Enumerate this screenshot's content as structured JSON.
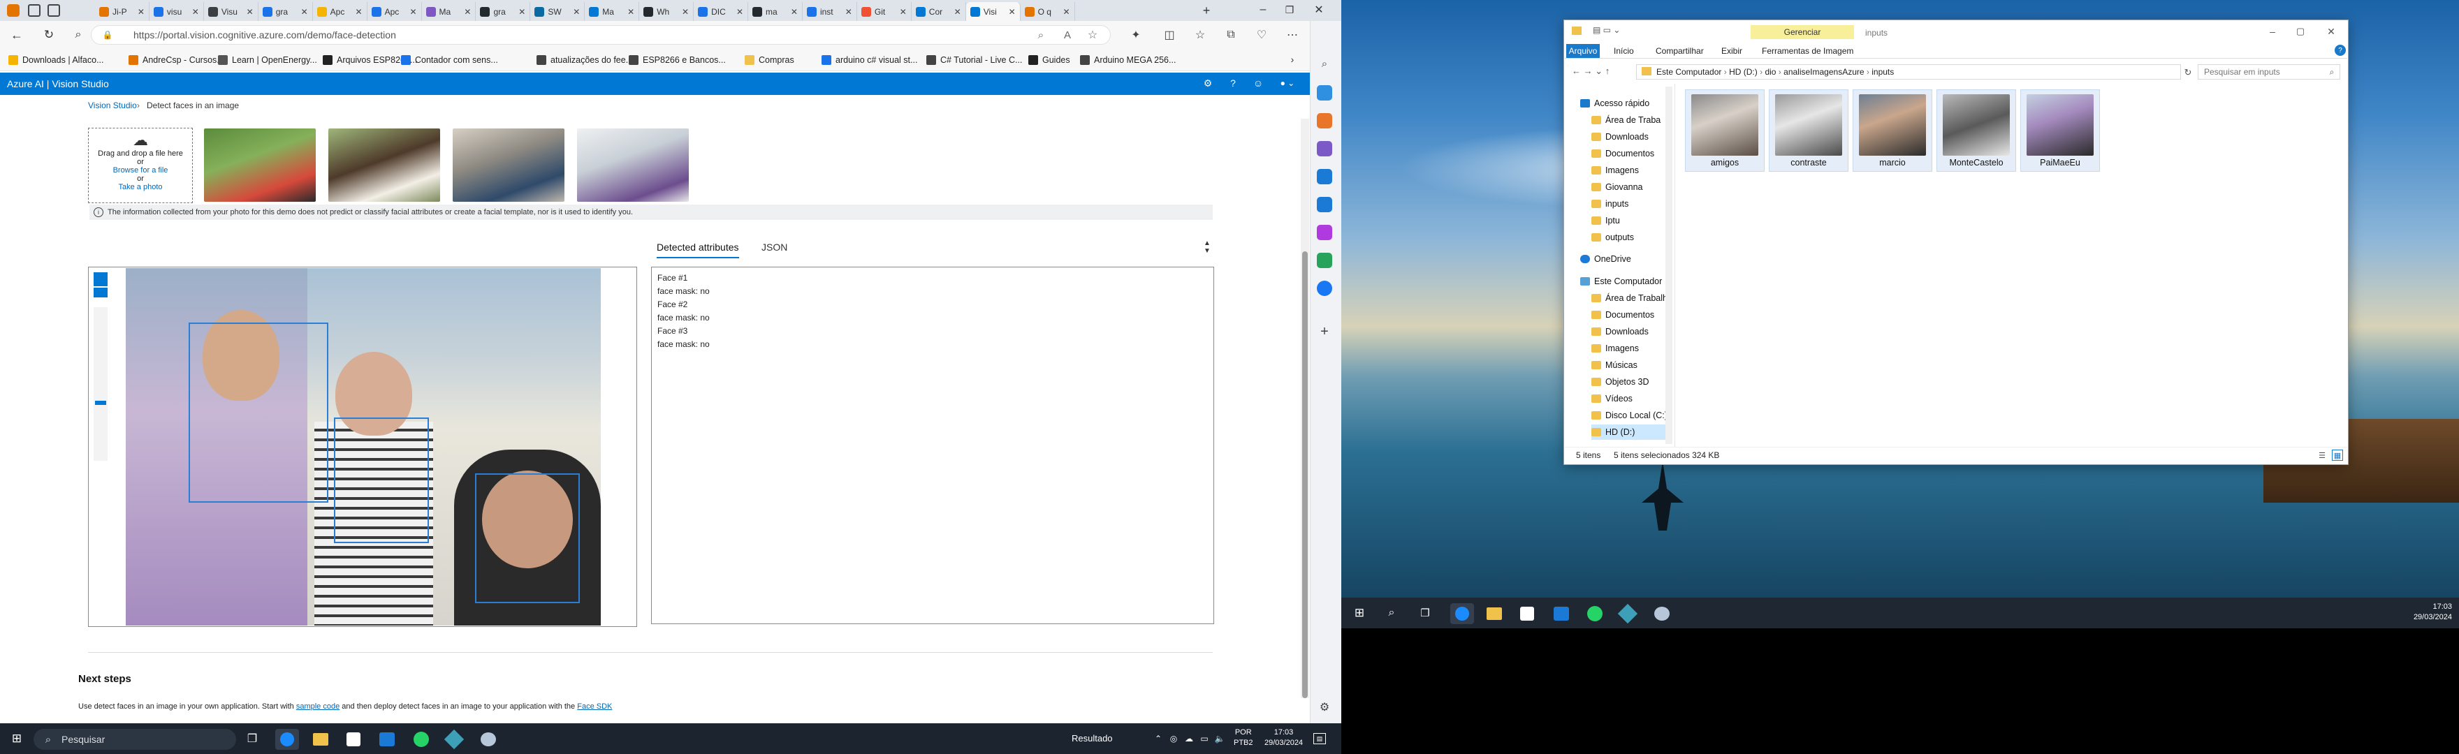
{
  "browser": {
    "tabs": [
      {
        "label": "Ji-P",
        "color": "#e37400"
      },
      {
        "label": "visu",
        "color": "#1a73e8"
      },
      {
        "label": "Visu",
        "color": "#3c4043"
      },
      {
        "label": "gra",
        "color": "#1a73e8"
      },
      {
        "label": "Apc",
        "color": "#f4b400"
      },
      {
        "label": "Apc",
        "color": "#1a73e8"
      },
      {
        "label": "Ma",
        "color": "#7e57c2"
      },
      {
        "label": "gra",
        "color": "#24292e"
      },
      {
        "label": "SW",
        "color": "#0b6aa2"
      },
      {
        "label": "Ma",
        "color": "#0078d4"
      },
      {
        "label": "Wh",
        "color": "#24292e"
      },
      {
        "label": "DIC",
        "color": "#1a73e8"
      },
      {
        "label": "ma",
        "color": "#24292e"
      },
      {
        "label": "inst",
        "color": "#1a73e8"
      },
      {
        "label": "Git",
        "color": "#f05133"
      },
      {
        "label": "Cor",
        "color": "#0078d4"
      },
      {
        "label": "Visi",
        "color": "#0078d4"
      },
      {
        "label": "O q",
        "color": "#e37400"
      }
    ],
    "url": "https://portal.vision.cognitive.azure.com/demo/face-detection",
    "favorites": [
      "Downloads | Alfaco...",
      "AndreCsp - Cursos...",
      "Learn | OpenEnergy...",
      "Arquivos ESP8266...",
      "Contador com sens...",
      "atualizações do fee...",
      "ESP8266 e Bancos...",
      "Compras",
      "arduino c# visual st...",
      "C# Tutorial - Live C...",
      "Guides",
      "Arduino MEGA 256..."
    ]
  },
  "azure": {
    "header": "Azure AI  |  Vision Studio",
    "crumb_root": "Vision Studio",
    "crumb_page": "Detect faces in an image",
    "drop_lines": [
      "Drag and drop a file here",
      "or",
      "Browse for a file",
      "or",
      "Take a photo"
    ],
    "info": "The information collected from your photo for this demo does not predict or classify facial attributes or create a facial template, nor is it used to identify you.",
    "tabs": [
      "Detected attributes",
      "JSON"
    ],
    "attributes": [
      "Face #1",
      "face mask: no",
      "Face #2",
      "face mask: no",
      "Face #3",
      "face mask: no"
    ],
    "next_steps_title": "Next steps",
    "next_steps_text_a": "Use detect faces in an image in your own application. Start with",
    "next_steps_link_a": "sample code",
    "next_steps_text_b": "and then deploy detect faces in an image to your application with the",
    "next_steps_link_b": "Face SDK"
  },
  "taskbar_left": {
    "search": "Pesquisar",
    "tray_label": "Resultado",
    "lang": "POR",
    "lang2": "PTB2",
    "time": "17:03",
    "date": "29/03/2024"
  },
  "explorer": {
    "ribbon_context": "Gerenciar",
    "title": "inputs",
    "tabs": [
      "Arquivo",
      "Início",
      "Compartilhar",
      "Exibir",
      "Ferramentas de Imagem"
    ],
    "path": [
      "Este Computador",
      "HD (D:)",
      "dio",
      "analiseImagensAzure",
      "inputs"
    ],
    "search_placeholder": "Pesquisar em inputs",
    "nav": [
      "Acesso rápido",
      "Área de Traba",
      "Downloads",
      "Documentos",
      "Imagens",
      "Giovanna",
      "inputs",
      "Iptu",
      "outputs",
      "OneDrive",
      "Este Computador",
      "Área de Trabalh",
      "Documentos",
      "Downloads",
      "Imagens",
      "Músicas",
      "Objetos 3D",
      "Vídeos",
      "Disco Local (C:)",
      "HD (D:)"
    ],
    "files": [
      "amigos",
      "contraste",
      "marcio",
      "MonteCastelo",
      "PaiMaeEu"
    ],
    "status_count": "5 itens",
    "status_sel": "5 itens selecionados  324 KB"
  },
  "taskbar_right": {
    "time": "17:03",
    "date": "29/03/2024"
  }
}
